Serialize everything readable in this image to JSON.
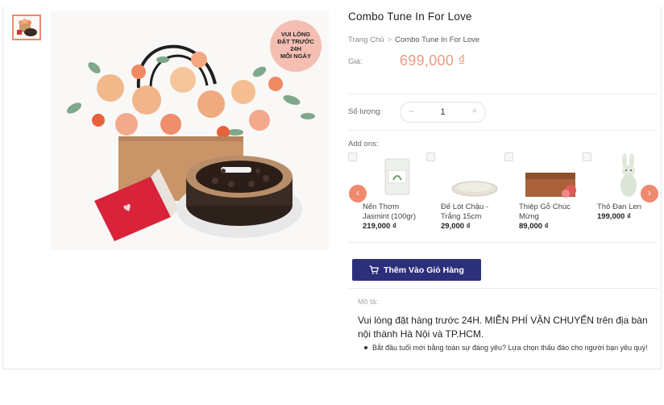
{
  "product": {
    "title": "Combo Tune In For Love",
    "badge": [
      "VUI LÒNG",
      "ĐẶT TRƯỚC",
      "24H",
      "MỖI NGÀY"
    ],
    "price_label": "Giá:",
    "price": "699,000 ₫"
  },
  "breadcrumb": {
    "home": "Trang Chủ",
    "separator": ">",
    "current": "Combo Tune In For Love"
  },
  "quantity": {
    "label": "Số lượng:",
    "minus": "−",
    "value": "1",
    "plus": "+"
  },
  "addons": {
    "label": "Add ons:",
    "items": [
      {
        "name": "Nến Thơm Jasmint (100gr)",
        "price": "219,000 ₫"
      },
      {
        "name": "Đế Lót Chậu - Trắng 15cm",
        "price": "29,000 ₫"
      },
      {
        "name": "Thiệp Gỗ Chúc Mừng",
        "price": "89,000 ₫"
      },
      {
        "name": "Thỏ Đan Len",
        "price": "199,000 ₫"
      }
    ],
    "prev_arrow": "‹",
    "next_arrow": "›"
  },
  "cart": {
    "label": "Thêm Vào Giỏ Hàng"
  },
  "description": {
    "label": "Mô tả:",
    "text": "Vui lòng đặt hàng trước 24H. MIỄN PHÍ VẬN CHUYỂN trên địa bàn nội thành Hà Nội và TP.HCM.",
    "bullet": "Bắt đầu tuổi mới bằng toàn sự đáng yêu? Lựa chọn thấu đáo cho người bạn yêu quý!"
  },
  "colors": {
    "accent": "#ef9a80",
    "button": "#2c2f7a",
    "arrow": "#ef8a6e"
  }
}
